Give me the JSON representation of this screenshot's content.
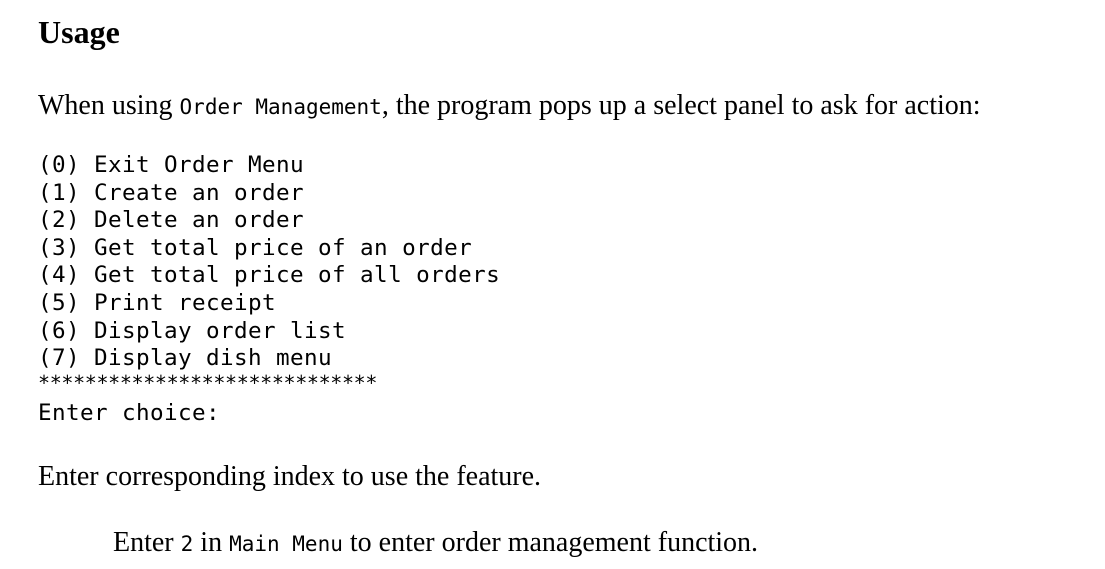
{
  "heading": "Usage",
  "intro": {
    "before": "When using ",
    "code": "Order Management",
    "after": ", the program pops up a select panel to ask for action:"
  },
  "menu": {
    "options": [
      "(0) Exit Order Menu",
      "(1) Create an order",
      "(2) Delete an order",
      "(3) Get total price of an order",
      "(4) Get total price of all orders",
      "(5) Print receipt",
      "(6) Display order list",
      "(7) Display dish menu"
    ],
    "separator": "*****************************",
    "prompt": "Enter choice:"
  },
  "outro": "Enter corresponding index to use the feature.",
  "note": {
    "before": "Enter ",
    "code_number": "2",
    "middle": " in ",
    "code_menu": "Main Menu",
    "after": " to enter order management function."
  }
}
